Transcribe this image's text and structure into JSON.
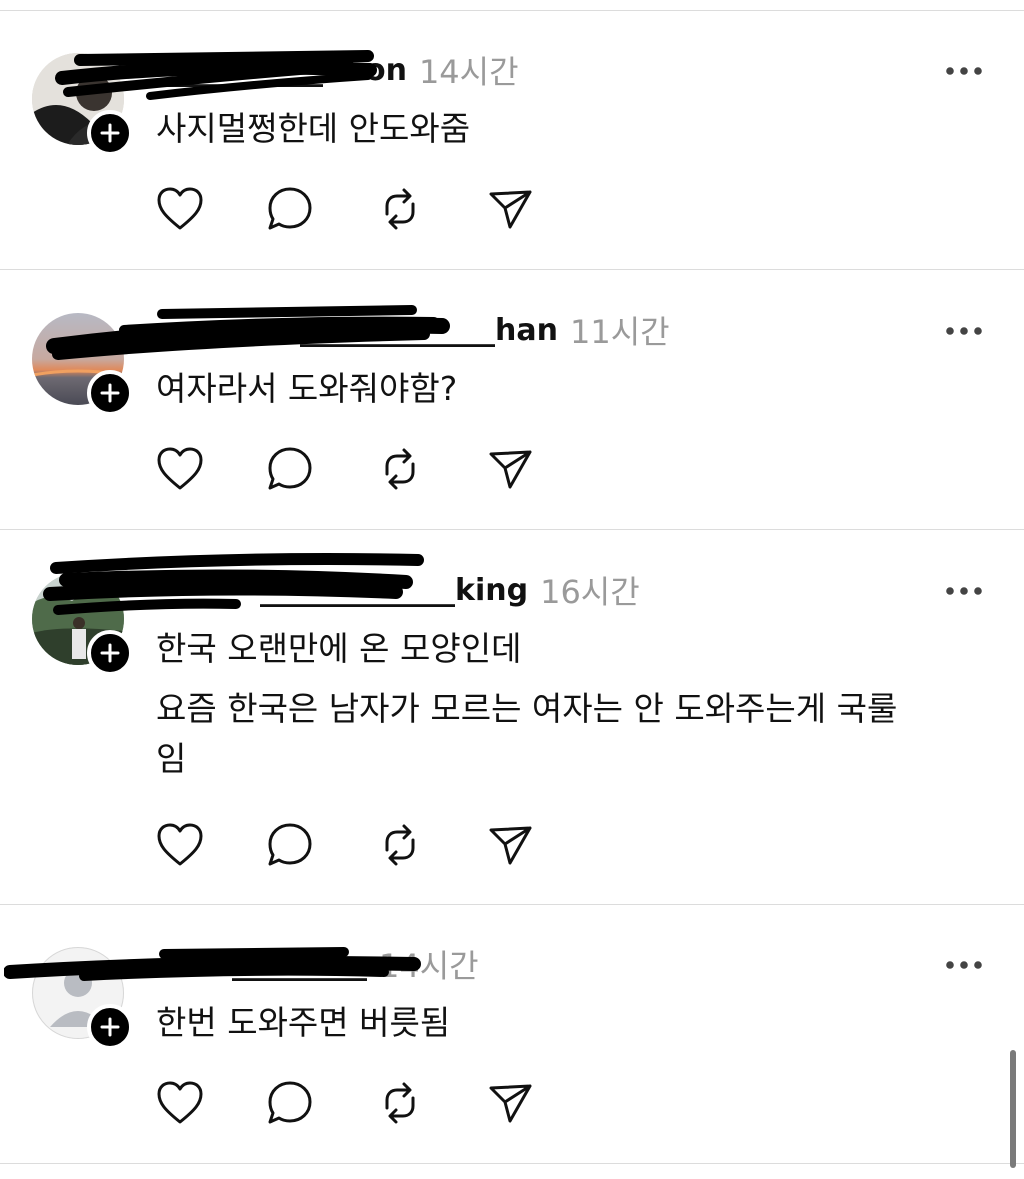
{
  "posts": [
    {
      "username": "___________hoon",
      "time": "14시간",
      "lines": [
        "사지멀쩡한데 안도와줌"
      ],
      "avatar_icon": "profile-photo"
    },
    {
      "username": "_____________han",
      "time": "11시간",
      "lines": [
        "여자라서 도와줘야함?"
      ],
      "avatar_icon": "sunset-photo"
    },
    {
      "username": "_____________king",
      "time": "16시간",
      "lines": [
        "한국 오랜만에 온 모양인데",
        "요즘 한국은 남자가 모르는 여자는 안 도와주는게 국룰",
        "임"
      ],
      "avatar_icon": "outdoor-photo"
    },
    {
      "username": "_________",
      "time": "14시간",
      "lines": [
        "한번 도와주면 버릇됨"
      ],
      "avatar_icon": "default-avatar"
    }
  ],
  "icons": {
    "like": "heart-icon",
    "reply": "comment-icon",
    "repost": "repost-icon",
    "share": "send-icon",
    "more": "more-icon",
    "follow": "plus-icon"
  },
  "colors": {
    "text": "#111111",
    "muted": "#9a9a9a",
    "divider": "#dcdcdc",
    "redaction": "#000000"
  }
}
